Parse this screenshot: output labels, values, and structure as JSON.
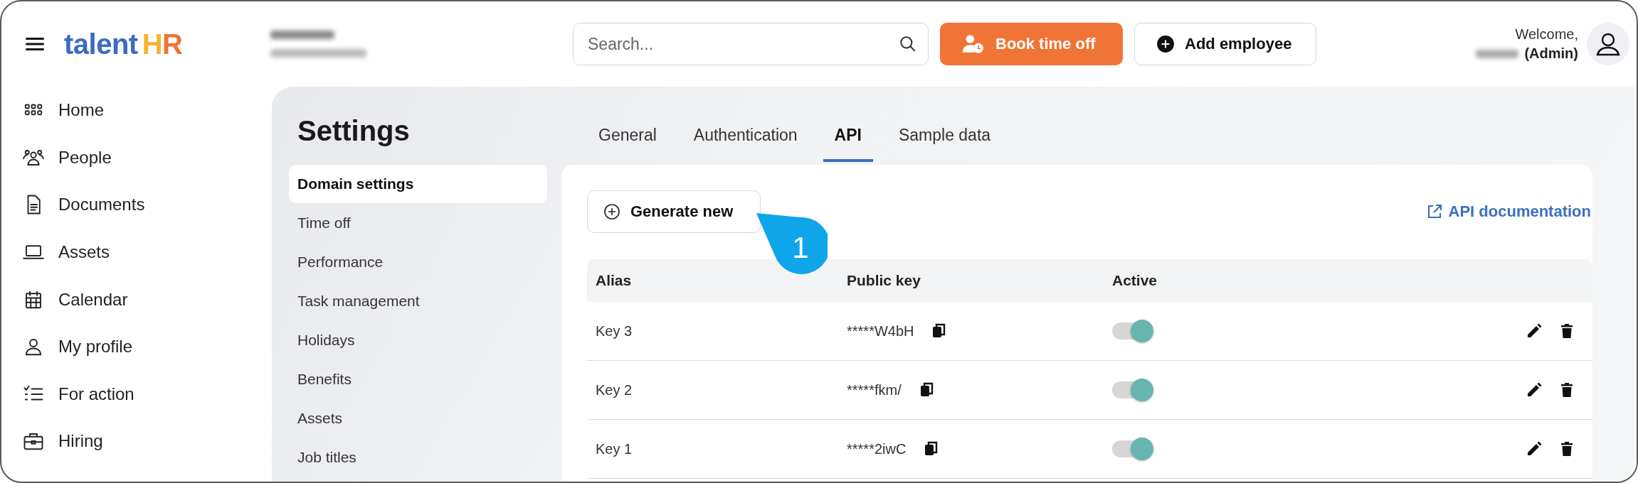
{
  "logo": {
    "text": "talent",
    "accent": "HR"
  },
  "sidebar": {
    "items": [
      {
        "label": "Home"
      },
      {
        "label": "People"
      },
      {
        "label": "Documents"
      },
      {
        "label": "Assets"
      },
      {
        "label": "Calendar"
      },
      {
        "label": "My profile"
      },
      {
        "label": "For action"
      },
      {
        "label": "Hiring"
      }
    ]
  },
  "header": {
    "search": {
      "placeholder": "Search..."
    },
    "buttons": [
      {
        "kind": "primary",
        "label": "Book time off"
      },
      {
        "kind": "secondary",
        "label": "Add employee"
      }
    ],
    "welcome": "Welcome,",
    "role": "(Admin)"
  },
  "settings": {
    "title": "Settings",
    "nav": [
      {
        "label": "Domain settings",
        "selected": true
      },
      {
        "label": "Time off",
        "selected": false
      },
      {
        "label": "Performance",
        "selected": false
      },
      {
        "label": "Task management",
        "selected": false
      },
      {
        "label": "Holidays",
        "selected": false
      },
      {
        "label": "Benefits",
        "selected": false
      },
      {
        "label": "Assets",
        "selected": false
      },
      {
        "label": "Job titles",
        "selected": false
      }
    ]
  },
  "tabs": [
    {
      "label": "General",
      "selected": false
    },
    {
      "label": "Authentication",
      "selected": false
    },
    {
      "label": "API",
      "selected": true
    },
    {
      "label": "Sample data",
      "selected": false
    }
  ],
  "api": {
    "generate_button": "Generate new",
    "step_marker": "1",
    "doc_link": "API documentation",
    "table": {
      "columns": [
        "Alias",
        "Public key",
        "Active"
      ],
      "rows": [
        {
          "alias": "Key 3",
          "public_key": "*****W4bH",
          "active": true
        },
        {
          "alias": "Key 2",
          "public_key": "*****fkm/",
          "active": true
        },
        {
          "alias": "Key 1",
          "public_key": "*****2iwC",
          "active": true
        }
      ]
    }
  }
}
